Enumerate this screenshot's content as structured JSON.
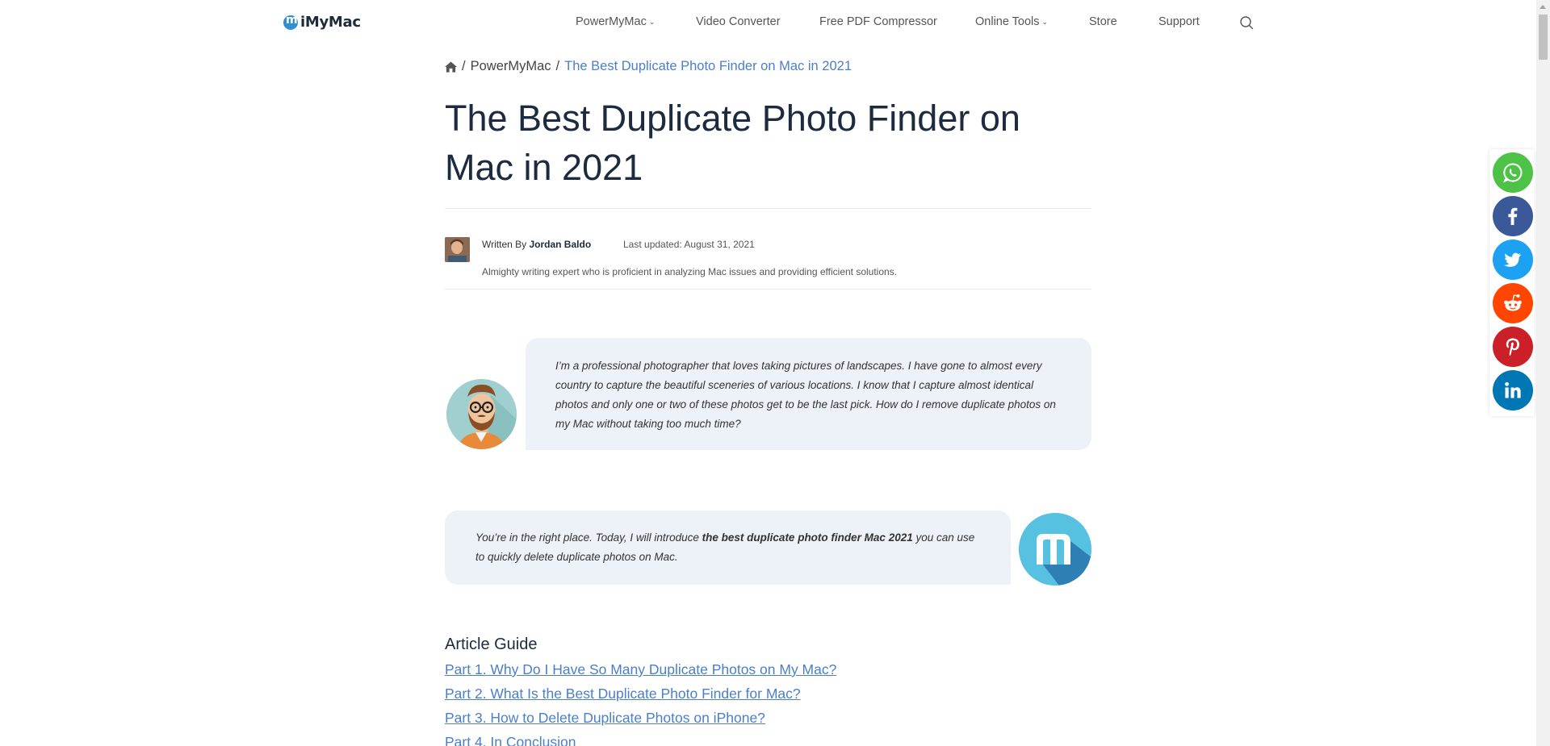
{
  "header": {
    "logo_text": "iMyMac",
    "nav": [
      {
        "label": "PowerMyMac",
        "has_dropdown": true
      },
      {
        "label": "Video Converter",
        "has_dropdown": false
      },
      {
        "label": "Free PDF Compressor",
        "has_dropdown": false
      },
      {
        "label": "Online Tools",
        "has_dropdown": true
      },
      {
        "label": "Store",
        "has_dropdown": false
      },
      {
        "label": "Support",
        "has_dropdown": false
      }
    ],
    "search_icon": "search-icon"
  },
  "breadcrumb": {
    "home_icon": "home-icon",
    "separator": "/",
    "items": [
      "PowerMyMac",
      "The Best Duplicate Photo Finder on Mac in 2021"
    ]
  },
  "article": {
    "title": "The Best Duplicate Photo Finder on Mac in 2021",
    "author": {
      "written_by": "Written By",
      "name": "Jordan Baldo",
      "updated": "Last updated: August 31, 2021",
      "bio": "Almighty writing expert who is proficient in analyzing Mac issues and providing efficient solutions."
    },
    "user_message": "I’m a professional photographer that loves taking pictures of landscapes. I have gone to almost every country to capture the beautiful sceneries of various locations. I know that I capture almost identical photos and only one or two of these photos get to be the last pick. How do I remove duplicate photos on my Mac without taking too much time?",
    "reply": {
      "before": "You’re in the right place. Today, I will introduce ",
      "bold": "the best duplicate photo finder Mac 2021",
      "after": " you can use to quickly delete duplicate photos on Mac."
    },
    "guide": {
      "title": "Article Guide",
      "links": [
        "Part 1. Why Do I Have So Many Duplicate Photos on My Mac?",
        "Part 2. What Is the Best Duplicate Photo Finder for Mac?",
        "Part 3. How to Delete Duplicate Photos on iPhone?",
        "Part 4. In Conclusion"
      ]
    }
  },
  "share": [
    {
      "network": "whatsapp",
      "icon": "whatsapp-icon",
      "color": "#4dc247"
    },
    {
      "network": "facebook",
      "icon": "facebook-icon",
      "color": "#3b5998"
    },
    {
      "network": "twitter",
      "icon": "twitter-icon",
      "color": "#1da1f2"
    },
    {
      "network": "reddit",
      "icon": "reddit-icon",
      "color": "#ff4500"
    },
    {
      "network": "pinterest",
      "icon": "pinterest-icon",
      "color": "#cb2027"
    },
    {
      "network": "linkedin",
      "icon": "linkedin-icon",
      "color": "#0077b5"
    }
  ]
}
